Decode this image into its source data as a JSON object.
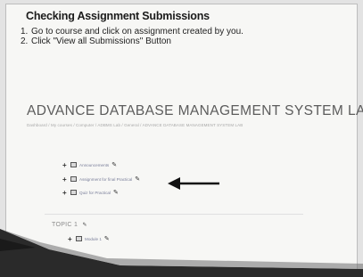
{
  "slide": {
    "heading": "Checking Assignment Submissions",
    "steps": [
      {
        "num": "1.",
        "text": "Go to course and click on assignment created by you."
      },
      {
        "num": "2.",
        "text": "Click \"View all Submissions\" Button"
      }
    ]
  },
  "screenshot": {
    "course_title": "ADVANCE DATABASE MANAGEMENT SYSTEM LAB",
    "breadcrumb": "Dashboard / My courses / Computer / ADBMS Lab / General / ADVANCE DATABASE MANAGEMENT SYSTEM LAB",
    "activities": [
      {
        "label": "Announcements",
        "icon": "forum-icon"
      },
      {
        "label": "Assignment for final Practical",
        "icon": "assignment-icon"
      },
      {
        "label": "Quiz for Practical",
        "icon": "quiz-icon"
      }
    ],
    "topic": {
      "label": "TOPIC 1",
      "activity": {
        "label": "Module 1",
        "icon": "folder-icon"
      }
    }
  },
  "colors": {
    "slide_bg": "#f7f7f5",
    "arrow": "#111111",
    "glare": "#2a2a2a"
  }
}
